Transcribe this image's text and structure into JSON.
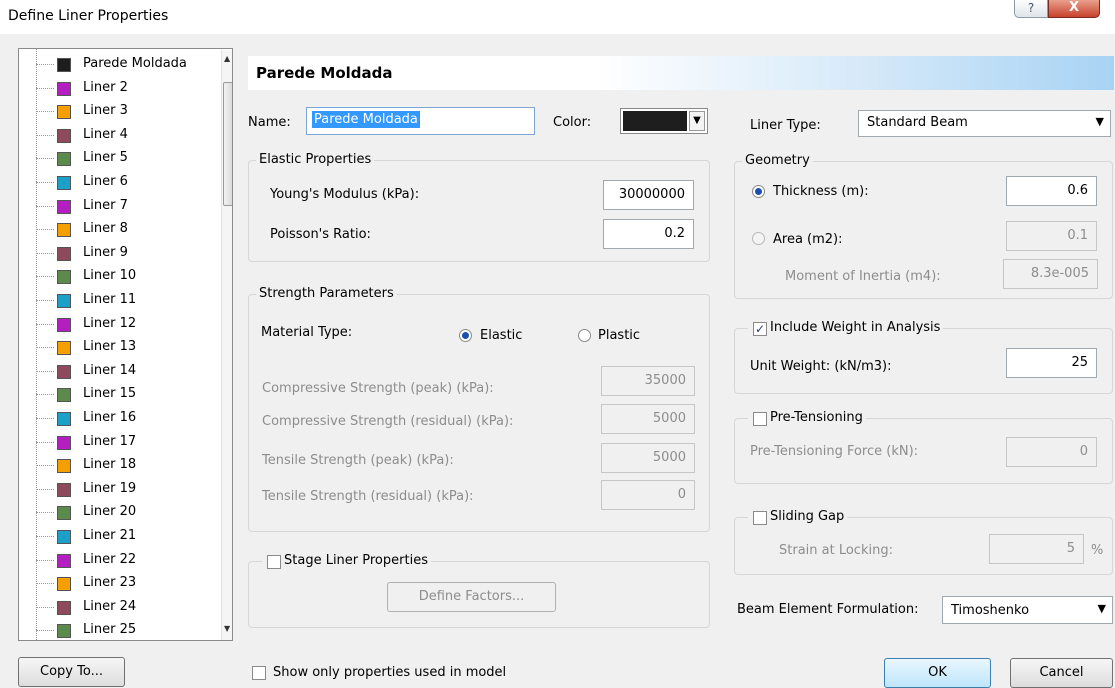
{
  "window": {
    "title": "Define Liner Properties",
    "help_label": "?",
    "close_label": "X"
  },
  "liner_list": [
    {
      "label": "Parede Moldada",
      "color": "#1e1e1e"
    },
    {
      "label": "Liner 2",
      "color": "#b21ec0"
    },
    {
      "label": "Liner 3",
      "color": "#f5a000"
    },
    {
      "label": "Liner 4",
      "color": "#8e4a5c"
    },
    {
      "label": "Liner 5",
      "color": "#5c8a4c"
    },
    {
      "label": "Liner 6",
      "color": "#1ca0c8"
    },
    {
      "label": "Liner 7",
      "color": "#b21ec0"
    },
    {
      "label": "Liner 8",
      "color": "#f5a000"
    },
    {
      "label": "Liner 9",
      "color": "#8e4a5c"
    },
    {
      "label": "Liner 10",
      "color": "#5c8a4c"
    },
    {
      "label": "Liner 11",
      "color": "#1ca0c8"
    },
    {
      "label": "Liner 12",
      "color": "#b21ec0"
    },
    {
      "label": "Liner 13",
      "color": "#f5a000"
    },
    {
      "label": "Liner 14",
      "color": "#8e4a5c"
    },
    {
      "label": "Liner 15",
      "color": "#5c8a4c"
    },
    {
      "label": "Liner 16",
      "color": "#1ca0c8"
    },
    {
      "label": "Liner 17",
      "color": "#b21ec0"
    },
    {
      "label": "Liner 18",
      "color": "#f5a000"
    },
    {
      "label": "Liner 19",
      "color": "#8e4a5c"
    },
    {
      "label": "Liner 20",
      "color": "#5c8a4c"
    },
    {
      "label": "Liner 21",
      "color": "#1ca0c8"
    },
    {
      "label": "Liner 22",
      "color": "#b21ec0"
    },
    {
      "label": "Liner 23",
      "color": "#f5a000"
    },
    {
      "label": "Liner 24",
      "color": "#8e4a5c"
    },
    {
      "label": "Liner 25",
      "color": "#5c8a4c"
    }
  ],
  "header": {
    "title": "Parede Moldada"
  },
  "name_field": {
    "label": "Name:",
    "value": "Parede Moldada"
  },
  "color_field": {
    "label": "Color:",
    "value": "#1e1e1e"
  },
  "liner_type": {
    "label": "Liner Type:",
    "value": "Standard Beam"
  },
  "elastic": {
    "title": "Elastic Properties",
    "youngs_label": "Young's Modulus (kPa):",
    "youngs_value": "30000000",
    "poisson_label": "Poisson's Ratio:",
    "poisson_value": "0.2"
  },
  "strength": {
    "title": "Strength Parameters",
    "material_label": "Material Type:",
    "elastic_label": "Elastic",
    "plastic_label": "Plastic",
    "comp_peak_label": "Compressive Strength (peak) (kPa):",
    "comp_peak_value": "35000",
    "comp_res_label": "Compressive Strength (residual) (kPa):",
    "comp_res_value": "5000",
    "tens_peak_label": "Tensile Strength (peak) (kPa):",
    "tens_peak_value": "5000",
    "tens_res_label": "Tensile Strength (residual) (kPa):",
    "tens_res_value": "0"
  },
  "stage": {
    "label": "Stage Liner Properties",
    "define_factors_label": "Define Factors..."
  },
  "geometry": {
    "title": "Geometry",
    "thickness_label": "Thickness (m):",
    "thickness_value": "0.6",
    "area_label": "Area (m2):",
    "area_value": "0.1",
    "moment_label": "Moment of Inertia (m4):",
    "moment_value": "8.3e-005"
  },
  "weight": {
    "label": "Include Weight in Analysis",
    "unit_weight_label": "Unit Weight: (kN/m3):",
    "unit_weight_value": "25"
  },
  "pretension": {
    "label": "Pre-Tensioning",
    "force_label": "Pre-Tensioning Force (kN):",
    "force_value": "0"
  },
  "sliding": {
    "label": "Sliding Gap",
    "strain_label": "Strain at Locking:",
    "strain_value": "5",
    "strain_unit": "%"
  },
  "beam": {
    "label": "Beam Element Formulation:",
    "value": "Timoshenko"
  },
  "footer": {
    "copy_to_label": "Copy To...",
    "show_only_label": "Show only properties used in model",
    "ok_label": "OK",
    "cancel_label": "Cancel"
  }
}
